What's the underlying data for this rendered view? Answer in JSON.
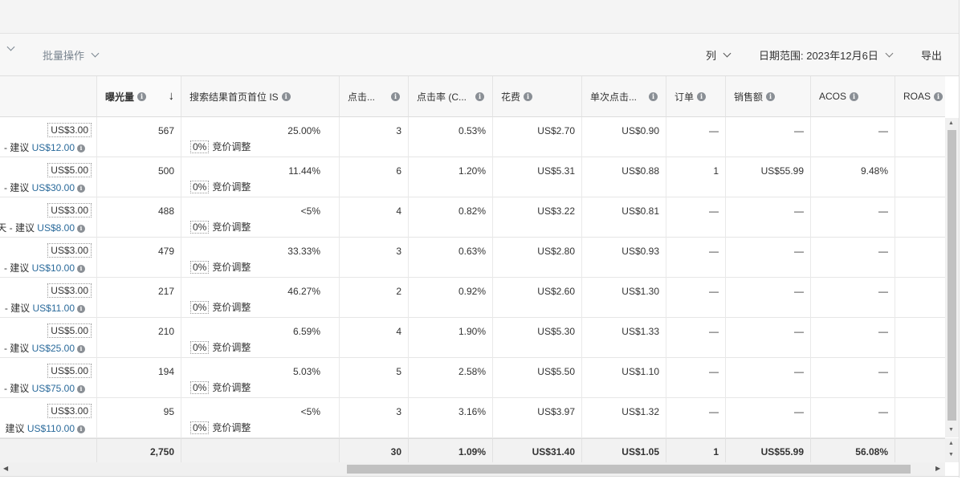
{
  "toolbar": {
    "bulk_actions": "批量操作",
    "columns": "列",
    "date_range": "日期范围: 2023年12月6日",
    "export": "导出"
  },
  "headers": {
    "impressions": "曝光量",
    "top_of_search_is": "搜索结果首页首位 IS",
    "clicks": "点击...",
    "ctr": "点击率 (C...",
    "spend": "花费",
    "cpc": "单次点击...",
    "orders": "订单",
    "sales": "销售额",
    "acos": "ACOS",
    "roas": "ROAS"
  },
  "info_glyph": "i",
  "sort_arrow": "↓",
  "suggest_prefix": "- 建议",
  "adjust_label": "竞价调整",
  "rows": [
    {
      "bid": "US$3.00",
      "suggest_prefix": "- 建议",
      "suggest": "US$12.00",
      "impressions": "567",
      "is_pct": "25.00%",
      "adj": "0%",
      "clicks": "3",
      "ctr": "0.53%",
      "spend": "US$2.70",
      "cpc": "US$0.90",
      "orders": "—",
      "sales": "—",
      "acos": "—"
    },
    {
      "bid": "US$5.00",
      "suggest_prefix": "- 建议",
      "suggest": "US$30.00",
      "impressions": "500",
      "is_pct": "11.44%",
      "adj": "0%",
      "clicks": "6",
      "ctr": "1.20%",
      "spend": "US$5.31",
      "cpc": "US$0.88",
      "orders": "1",
      "sales": "US$55.99",
      "acos": "9.48%"
    },
    {
      "bid": "US$3.00",
      "suggest_prefix": "天 - 建议",
      "suggest": "US$8.00",
      "impressions": "488",
      "is_pct": "<5%",
      "adj": "0%",
      "clicks": "4",
      "ctr": "0.82%",
      "spend": "US$3.22",
      "cpc": "US$0.81",
      "orders": "—",
      "sales": "—",
      "acos": "—"
    },
    {
      "bid": "US$3.00",
      "suggest_prefix": "- 建议",
      "suggest": "US$10.00",
      "impressions": "479",
      "is_pct": "33.33%",
      "adj": "0%",
      "clicks": "3",
      "ctr": "0.63%",
      "spend": "US$2.80",
      "cpc": "US$0.93",
      "orders": "—",
      "sales": "—",
      "acos": "—"
    },
    {
      "bid": "US$3.00",
      "suggest_prefix": "- 建议",
      "suggest": "US$11.00",
      "impressions": "217",
      "is_pct": "46.27%",
      "adj": "0%",
      "clicks": "2",
      "ctr": "0.92%",
      "spend": "US$2.60",
      "cpc": "US$1.30",
      "orders": "—",
      "sales": "—",
      "acos": "—"
    },
    {
      "bid": "US$5.00",
      "suggest_prefix": "- 建议",
      "suggest": "US$25.00",
      "impressions": "210",
      "is_pct": "6.59%",
      "adj": "0%",
      "clicks": "4",
      "ctr": "1.90%",
      "spend": "US$5.30",
      "cpc": "US$1.33",
      "orders": "—",
      "sales": "—",
      "acos": "—"
    },
    {
      "bid": "US$5.00",
      "suggest_prefix": "- 建议",
      "suggest": "US$75.00",
      "impressions": "194",
      "is_pct": "5.03%",
      "adj": "0%",
      "clicks": "5",
      "ctr": "2.58%",
      "spend": "US$5.50",
      "cpc": "US$1.10",
      "orders": "—",
      "sales": "—",
      "acos": "—"
    },
    {
      "bid": "US$3.00",
      "suggest_prefix": "建议",
      "suggest": "US$110.00",
      "impressions": "95",
      "is_pct": "<5%",
      "adj": "0%",
      "clicks": "3",
      "ctr": "3.16%",
      "spend": "US$3.97",
      "cpc": "US$1.32",
      "orders": "—",
      "sales": "—",
      "acos": "—"
    }
  ],
  "totals": {
    "impressions": "2,750",
    "clicks": "30",
    "ctr": "1.09%",
    "spend": "US$31.40",
    "cpc": "US$1.05",
    "orders": "1",
    "sales": "US$55.99",
    "acos": "56.08%"
  }
}
